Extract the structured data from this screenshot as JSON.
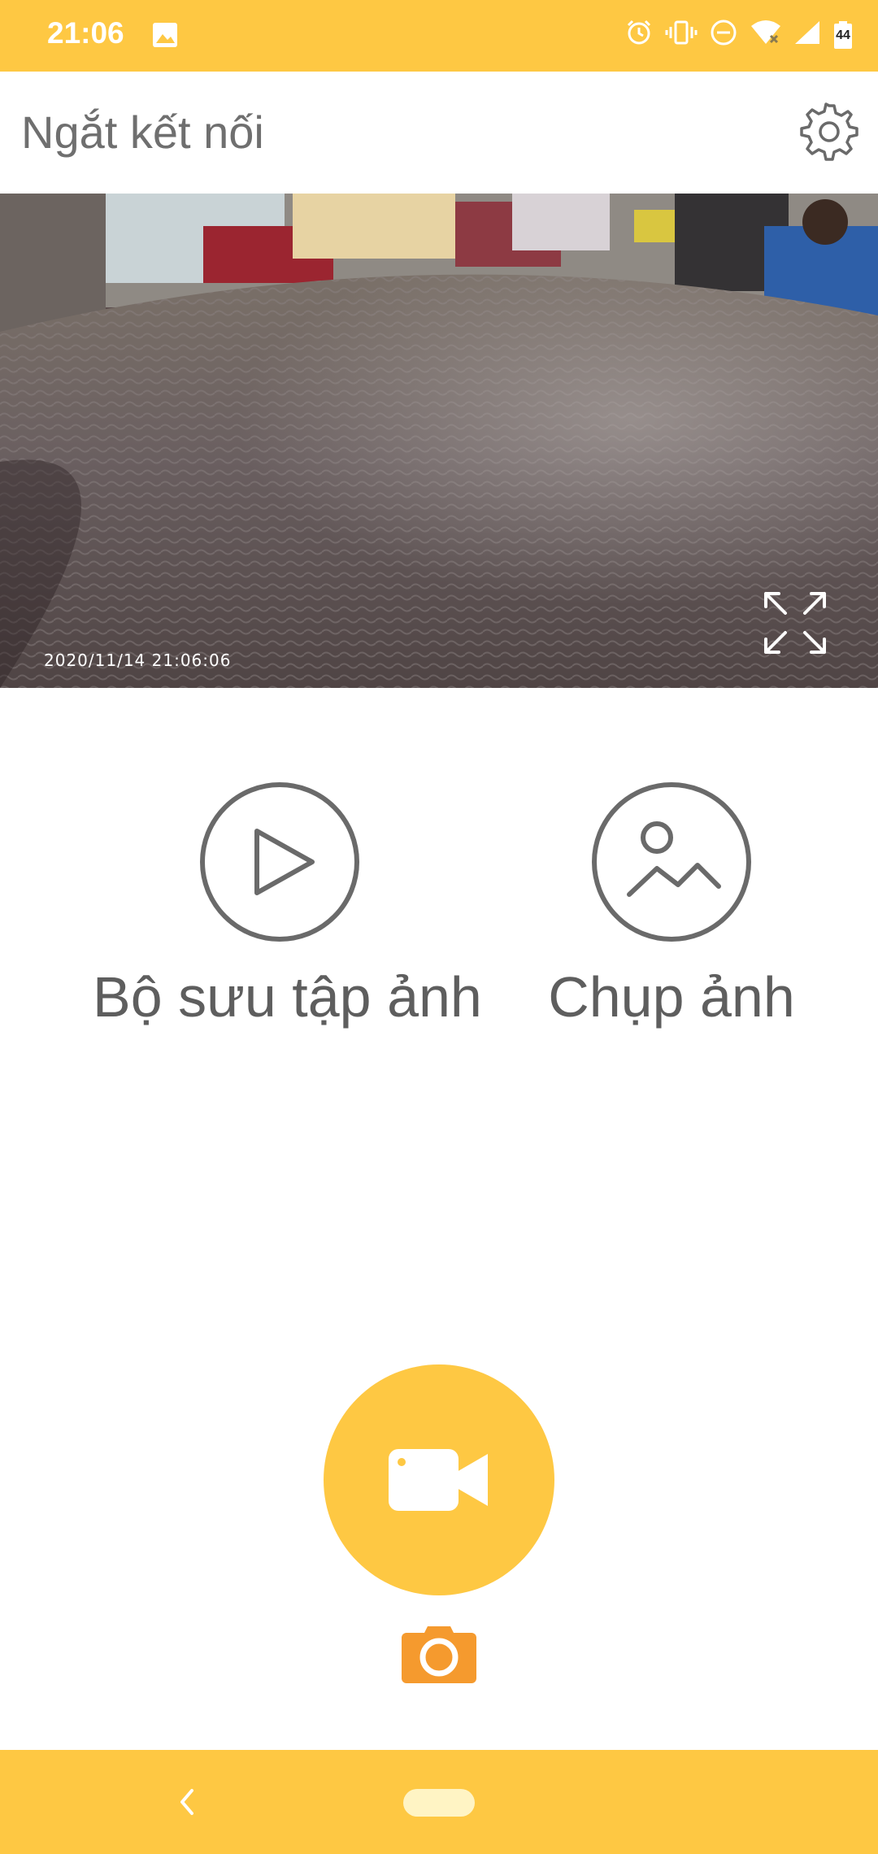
{
  "status_bar": {
    "time": "21:06",
    "battery_level": "44",
    "icons": [
      "gallery-icon",
      "alarm-icon",
      "vibrate-icon",
      "dnd-icon",
      "wifi-icon",
      "signal-icon",
      "battery-icon"
    ]
  },
  "app_bar": {
    "title": "Ngắt kết nối",
    "settings_icon": "gear-icon"
  },
  "video": {
    "timestamp": "2020/11/14  21:06:06",
    "fullscreen_icon": "expand-icon"
  },
  "actions": [
    {
      "label": "Bộ sưu tập ảnh",
      "icon": "play-circle-icon"
    },
    {
      "label": "Chụp ảnh",
      "icon": "image-circle-icon"
    }
  ],
  "record_button": {
    "icon": "video-camera-icon"
  },
  "photo_mode_button": {
    "icon": "camera-icon"
  },
  "nav_bar": {
    "back_icon": "back-icon",
    "home_icon": "home-pill-icon"
  },
  "colors": {
    "accent": "#FEC843",
    "camera_orange": "#F59A2E",
    "text_gray": "#5e5e5e",
    "icon_gray": "#6a6a6a"
  }
}
